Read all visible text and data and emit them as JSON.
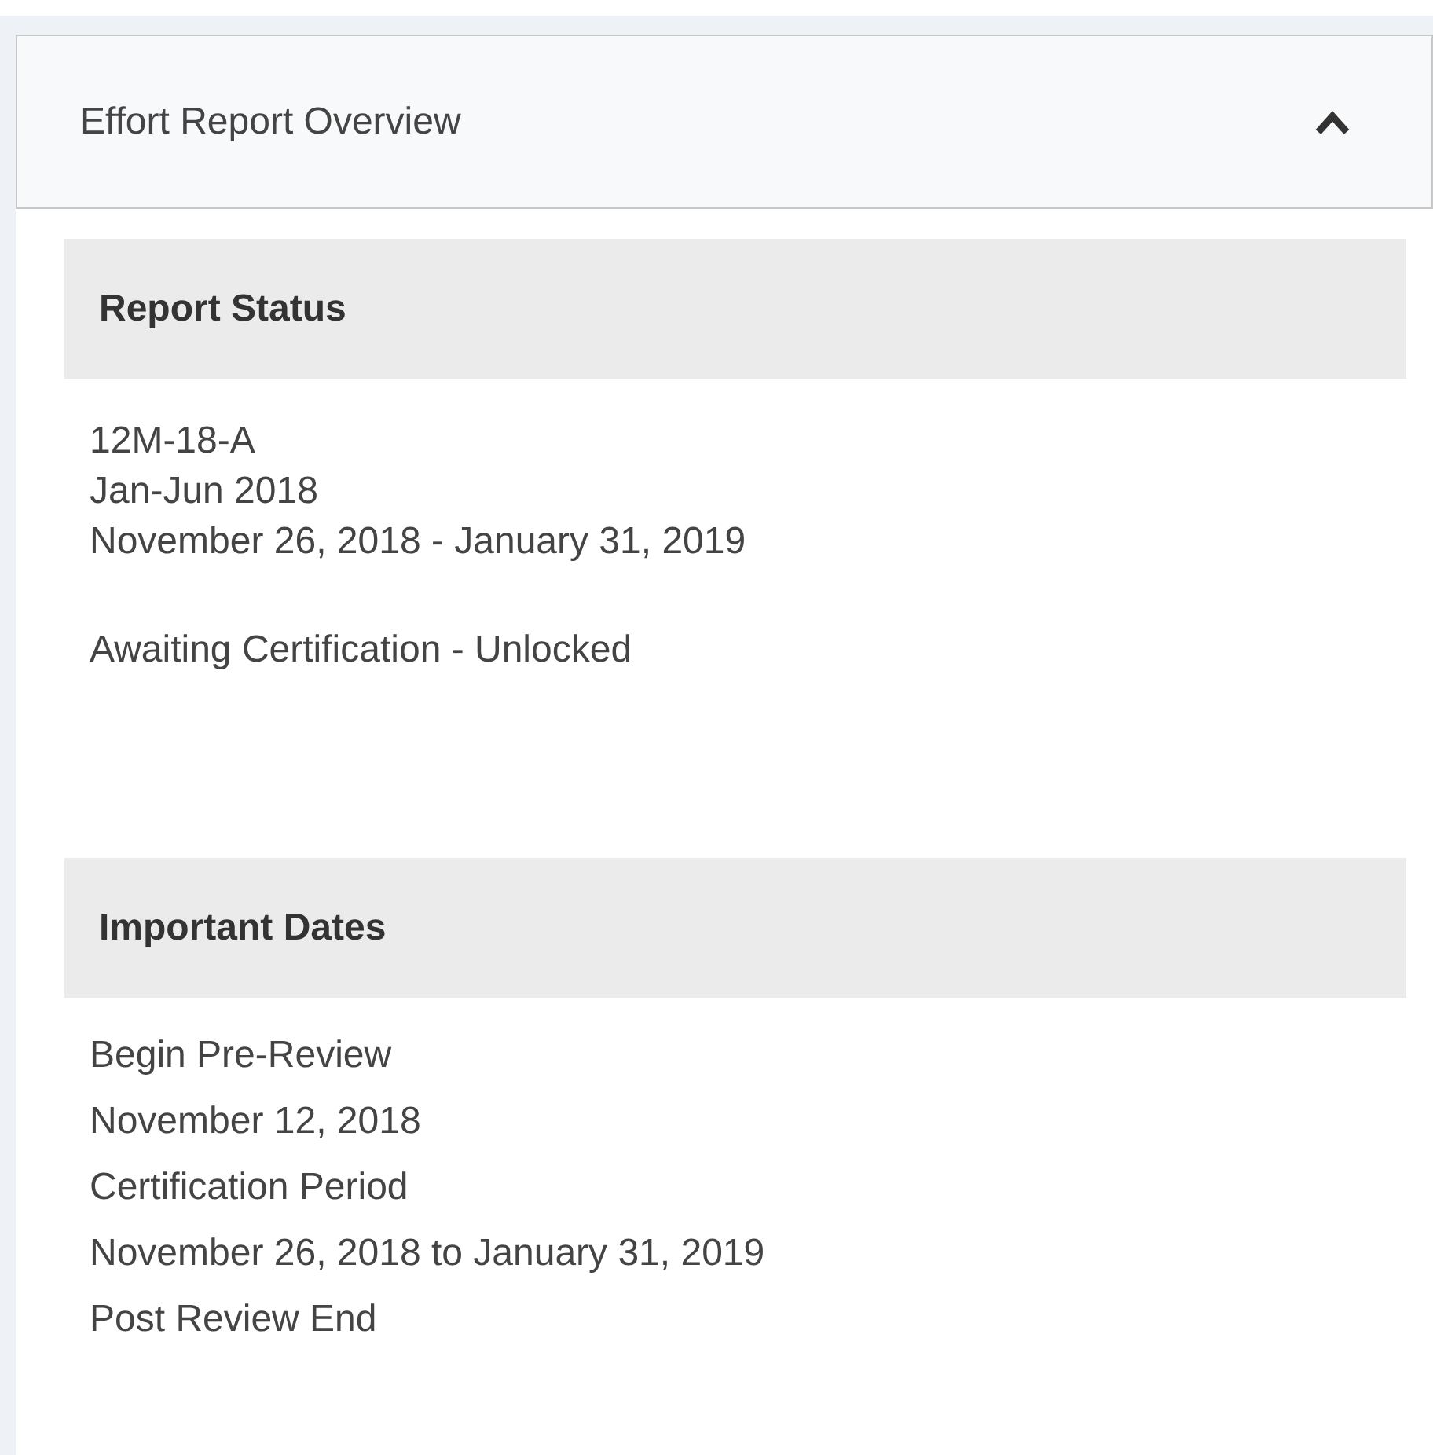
{
  "panel": {
    "title": "Effort Report Overview",
    "expanded": true
  },
  "sections": [
    {
      "heading": "Report Status",
      "kind": "status",
      "lines": [
        "12M-18-A",
        "Jan-Jun 2018",
        "November 26, 2018 - January 31, 2019"
      ],
      "status": "Awaiting Certification - Unlocked"
    },
    {
      "heading": "Important Dates",
      "kind": "dates",
      "lines": [
        "Begin Pre-Review",
        "November 12, 2018",
        "Certification Period",
        "November 26, 2018 to January 31, 2019",
        "Post Review End"
      ]
    }
  ]
}
